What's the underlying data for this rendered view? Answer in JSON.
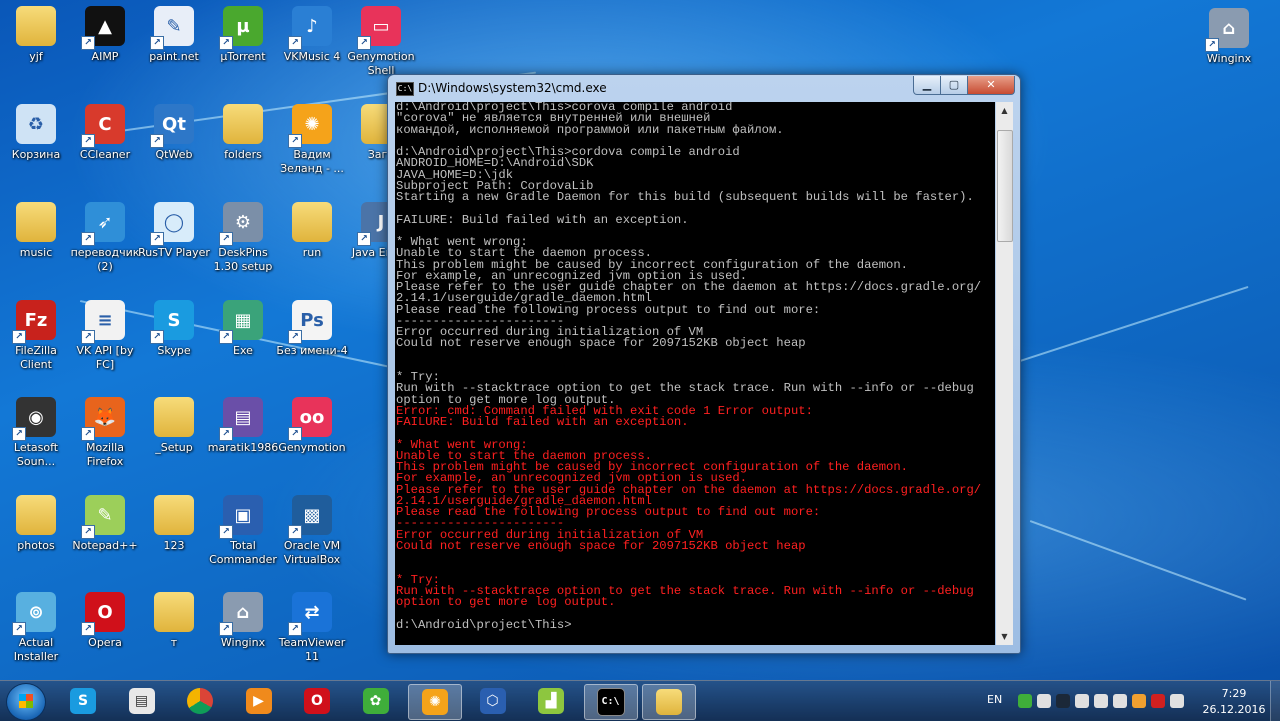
{
  "desktop": {
    "icons": [
      {
        "label": "yjf",
        "icon": "folder-icon"
      },
      {
        "label": "AIMP",
        "icon": "aimp-icon"
      },
      {
        "label": "paint.net",
        "icon": "paintnet-icon"
      },
      {
        "label": "µTorrent",
        "icon": "utorrent-icon"
      },
      {
        "label": "VKMusic 4",
        "icon": "vkmusic-icon"
      },
      {
        "label": "Genymotion Shell",
        "icon": "genymotion-shell-icon"
      },
      {
        "label": "Корзина",
        "icon": "recycle-bin-icon"
      },
      {
        "label": "CCleaner",
        "icon": "ccleaner-icon"
      },
      {
        "label": "QtWeb",
        "icon": "qtweb-icon"
      },
      {
        "label": "folders",
        "icon": "folder-icon"
      },
      {
        "label": "Вадим Зеланд - ...",
        "icon": "orange-slice-icon"
      },
      {
        "label": "Загр",
        "icon": "folder-icon"
      },
      {
        "label": "music",
        "icon": "folder-icon"
      },
      {
        "label": "переводчик (2)",
        "icon": "translator-icon"
      },
      {
        "label": "RusTV Player",
        "icon": "rustv-icon"
      },
      {
        "label": "DeskPins 1.30 setup",
        "icon": "installer-icon"
      },
      {
        "label": "run",
        "icon": "folder-icon"
      },
      {
        "label": "Java Embe",
        "icon": "java-icon"
      },
      {
        "label": "FileZilla Client",
        "icon": "filezilla-icon"
      },
      {
        "label": "VK API [by FC]",
        "icon": "document-icon"
      },
      {
        "label": "Skype",
        "icon": "skype-icon"
      },
      {
        "label": "Exe",
        "icon": "exe-cube-icon"
      },
      {
        "label": "Без имени-4",
        "icon": "photoshop-icon"
      },
      {
        "label": "Letasoft Soun...",
        "icon": "speaker-icon"
      },
      {
        "label": "Mozilla Firefox",
        "icon": "firefox-icon"
      },
      {
        "label": "_Setup",
        "icon": "folder-icon"
      },
      {
        "label": "maratik1986",
        "icon": "winrar-icon"
      },
      {
        "label": "Genymotion",
        "icon": "genymotion-icon"
      },
      {
        "label": "photos",
        "icon": "folder-icon"
      },
      {
        "label": "Notepad++",
        "icon": "notepadpp-icon"
      },
      {
        "label": "123",
        "icon": "folder-icon"
      },
      {
        "label": "Total Commander",
        "icon": "floppy-icon"
      },
      {
        "label": "Oracle VM VirtualBox",
        "icon": "virtualbox-icon"
      },
      {
        "label": "Actual Installer",
        "icon": "actual-installer-icon"
      },
      {
        "label": "Opera",
        "icon": "opera-icon"
      },
      {
        "label": "т",
        "icon": "folder-icon"
      },
      {
        "label": "Winginx",
        "icon": "winginx-icon"
      },
      {
        "label": "TeamViewer 11",
        "icon": "teamviewer-icon"
      },
      {
        "label": "Winginx",
        "icon": "winginx-icon"
      }
    ]
  },
  "cmd": {
    "title": "D:\\Windows\\system32\\cmd.exe",
    "lines": [
      {
        "t": "d:\\Android\\project\\This>corova compile android",
        "c": "w"
      },
      {
        "t": "\"corova\" не является внутренней или внешней",
        "c": "w"
      },
      {
        "t": "командой, исполняемой программой или пакетным файлом.",
        "c": "w"
      },
      {
        "t": "",
        "c": "w"
      },
      {
        "t": "d:\\Android\\project\\This>cordova compile android",
        "c": "w"
      },
      {
        "t": "ANDROID_HOME=D:\\Android\\SDK",
        "c": "w"
      },
      {
        "t": "JAVA_HOME=D:\\jdk",
        "c": "w"
      },
      {
        "t": "Subproject Path: CordovaLib",
        "c": "w"
      },
      {
        "t": "Starting a new Gradle Daemon for this build (subsequent builds will be faster).",
        "c": "w"
      },
      {
        "t": "",
        "c": "w"
      },
      {
        "t": "FAILURE: Build failed with an exception.",
        "c": "w"
      },
      {
        "t": "",
        "c": "w"
      },
      {
        "t": "* What went wrong:",
        "c": "w"
      },
      {
        "t": "Unable to start the daemon process.",
        "c": "w"
      },
      {
        "t": "This problem might be caused by incorrect configuration of the daemon.",
        "c": "w"
      },
      {
        "t": "For example, an unrecognized jvm option is used.",
        "c": "w"
      },
      {
        "t": "Please refer to the user guide chapter on the daemon at https://docs.gradle.org/",
        "c": "w"
      },
      {
        "t": "2.14.1/userguide/gradle_daemon.html",
        "c": "w"
      },
      {
        "t": "Please read the following process output to find out more:",
        "c": "w"
      },
      {
        "t": "-----------------------",
        "c": "w"
      },
      {
        "t": "Error occurred during initialization of VM",
        "c": "w"
      },
      {
        "t": "Could not reserve enough space for 2097152KB object heap",
        "c": "w"
      },
      {
        "t": "",
        "c": "w"
      },
      {
        "t": "",
        "c": "w"
      },
      {
        "t": "* Try:",
        "c": "w"
      },
      {
        "t": "Run with --stacktrace option to get the stack trace. Run with --info or --debug",
        "c": "w"
      },
      {
        "t": "option to get more log output.",
        "c": "w"
      },
      {
        "t": "Error: cmd: Command failed with exit code 1 Error output:",
        "c": "r"
      },
      {
        "t": "FAILURE: Build failed with an exception.",
        "c": "r"
      },
      {
        "t": "",
        "c": "r"
      },
      {
        "t": "* What went wrong:",
        "c": "r"
      },
      {
        "t": "Unable to start the daemon process.",
        "c": "r"
      },
      {
        "t": "This problem might be caused by incorrect configuration of the daemon.",
        "c": "r"
      },
      {
        "t": "For example, an unrecognized jvm option is used.",
        "c": "r"
      },
      {
        "t": "Please refer to the user guide chapter on the daemon at https://docs.gradle.org/",
        "c": "r"
      },
      {
        "t": "2.14.1/userguide/gradle_daemon.html",
        "c": "r"
      },
      {
        "t": "Please read the following process output to find out more:",
        "c": "r"
      },
      {
        "t": "-----------------------",
        "c": "r"
      },
      {
        "t": "Error occurred during initialization of VM",
        "c": "r"
      },
      {
        "t": "Could not reserve enough space for 2097152KB object heap",
        "c": "r"
      },
      {
        "t": "",
        "c": "r"
      },
      {
        "t": "",
        "c": "r"
      },
      {
        "t": "* Try:",
        "c": "r"
      },
      {
        "t": "Run with --stacktrace option to get the stack trace. Run with --info or --debug",
        "c": "r"
      },
      {
        "t": "option to get more log output.",
        "c": "r"
      },
      {
        "t": "",
        "c": "w"
      },
      {
        "t": "d:\\Android\\project\\This>",
        "c": "w"
      }
    ]
  },
  "taskbar": {
    "items": [
      {
        "icon": "skype-icon",
        "active": false
      },
      {
        "icon": "explorer-window-icon",
        "active": false
      },
      {
        "icon": "chrome-icon",
        "active": false
      },
      {
        "icon": "media-player-icon",
        "active": false
      },
      {
        "icon": "opera-icon",
        "active": false
      },
      {
        "icon": "icq-flower-icon",
        "active": false
      },
      {
        "icon": "orange-app-icon",
        "active": true
      },
      {
        "icon": "hexagon-app-icon",
        "active": false
      },
      {
        "icon": "chart-app-icon",
        "active": false
      },
      {
        "icon": "cmd-icon",
        "active": true
      },
      {
        "icon": "folder-icon",
        "active": true
      }
    ],
    "tray": {
      "language": "EN",
      "icons": [
        "clover-icon",
        "flag-icon",
        "steam-icon",
        "volume-icon",
        "signal-icon",
        "network-icon",
        "browser-icon",
        "error-icon",
        "action-center-icon"
      ]
    },
    "clock": {
      "time": "7:29",
      "date": "26.12.2016"
    }
  },
  "colors": {
    "console_text": "#c0c0c0",
    "console_error": "#ff2020",
    "console_bg": "#000000"
  }
}
